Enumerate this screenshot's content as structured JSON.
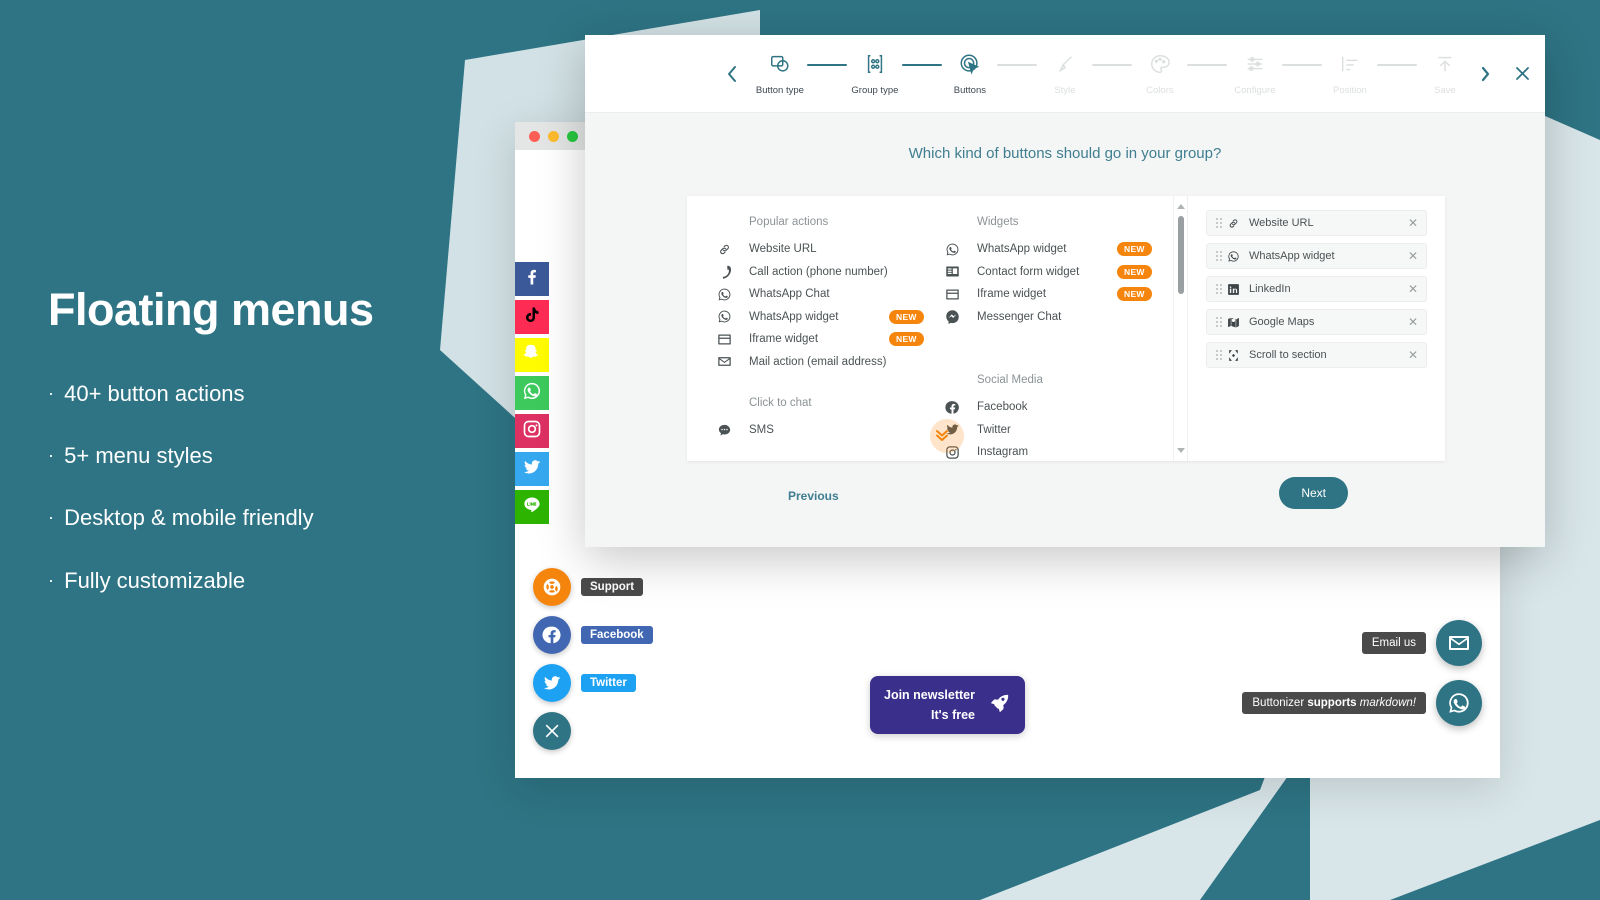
{
  "marketing": {
    "title": "Floating menus",
    "features": [
      "40+ button actions",
      "5+ menu styles",
      "Desktop & mobile friendly",
      "Fully customizable"
    ],
    "bullet": "·"
  },
  "theme": {
    "brand_teal": "#2e7484",
    "accent_orange": "#f5850c",
    "panel_bg": "#f4f5f5",
    "question_color": "#3f7e90"
  },
  "browser": {
    "traffic_lights": [
      "red",
      "yellow",
      "green"
    ],
    "social_rail": [
      {
        "name": "Facebook",
        "icon": "facebook-icon",
        "color": "#3b5998"
      },
      {
        "name": "TikTok",
        "icon": "tiktok-icon",
        "color": "#fe2c55"
      },
      {
        "name": "Snapchat",
        "icon": "snapchat-icon",
        "color": "#fffc00"
      },
      {
        "name": "WhatsApp",
        "icon": "whatsapp-icon",
        "color": "#3ec95c"
      },
      {
        "name": "Instagram",
        "icon": "instagram-icon",
        "color": "#dd3163"
      },
      {
        "name": "Twitter",
        "icon": "twitter-icon",
        "color": "#35a8f0"
      },
      {
        "name": "Line",
        "icon": "line-icon",
        "color": "#2cb400"
      }
    ],
    "fab_menu": [
      {
        "label": "Support",
        "icon": "lifebuoy-icon",
        "fab_color": "#f5850c",
        "label_color": "#4a4a4a"
      },
      {
        "label": "Facebook",
        "icon": "facebook-icon",
        "fab_color": "#4267b2",
        "label_color": "#4267b2"
      },
      {
        "label": "Twitter",
        "icon": "twitter-icon",
        "fab_color": "#1da1f2",
        "label_color": "#1da1f2"
      }
    ],
    "fab_close_icon": "close-icon",
    "newsletter": {
      "line1": "Join newsletter",
      "line2": "It's free",
      "icon": "rocket-icon",
      "color": "#3b2f8c"
    },
    "right_fabs": [
      {
        "label_plain": "Email us",
        "icon": "envelope-icon"
      },
      {
        "label_markdown": {
          "pre": "Buttonizer ",
          "bold": "supports ",
          "italic": "markdown!"
        },
        "icon": "whatsapp-icon"
      }
    ]
  },
  "modal": {
    "nav_prev_icon": "chevron-left-icon",
    "nav_next_icon": "chevron-right-icon",
    "close_icon": "close-icon",
    "steps": [
      {
        "label": "Button type",
        "icon": "button-type-icon",
        "state": "done"
      },
      {
        "label": "Group type",
        "icon": "group-type-icon",
        "state": "done"
      },
      {
        "label": "Buttons",
        "icon": "cursor-click-icon",
        "state": "active"
      },
      {
        "label": "Style",
        "icon": "brush-icon",
        "state": "todo"
      },
      {
        "label": "Colors",
        "icon": "palette-icon",
        "state": "todo"
      },
      {
        "label": "Configure",
        "icon": "sliders-icon",
        "state": "todo"
      },
      {
        "label": "Position",
        "icon": "align-icon",
        "state": "todo"
      },
      {
        "label": "Save",
        "icon": "upload-icon",
        "state": "todo"
      }
    ],
    "question": "Which kind of buttons should go in your group?",
    "catalog": {
      "columns": [
        {
          "groups": [
            {
              "heading": "Popular actions",
              "items": [
                {
                  "label": "Website URL",
                  "icon": "link-icon",
                  "badge": ""
                },
                {
                  "label": "Call action (phone number)",
                  "icon": "phone-icon",
                  "badge": ""
                },
                {
                  "label": "WhatsApp Chat",
                  "icon": "whatsapp-icon",
                  "badge": ""
                },
                {
                  "label": "WhatsApp widget",
                  "icon": "whatsapp-icon",
                  "badge": "NEW"
                },
                {
                  "label": "Iframe widget",
                  "icon": "iframe-icon",
                  "badge": "NEW"
                },
                {
                  "label": "Mail action (email address)",
                  "icon": "envelope-icon",
                  "badge": ""
                }
              ]
            },
            {
              "heading": "Click to chat",
              "items": [
                {
                  "label": "SMS",
                  "icon": "chat-icon",
                  "badge": ""
                }
              ]
            }
          ]
        },
        {
          "groups": [
            {
              "heading": "Widgets",
              "items": [
                {
                  "label": "WhatsApp widget",
                  "icon": "whatsapp-icon",
                  "badge": "NEW"
                },
                {
                  "label": "Contact form widget",
                  "icon": "form-icon",
                  "badge": "NEW"
                },
                {
                  "label": "Iframe widget",
                  "icon": "iframe-icon",
                  "badge": "NEW"
                },
                {
                  "label": "Messenger Chat",
                  "icon": "messenger-icon",
                  "badge": ""
                }
              ]
            },
            {
              "heading": "Social Media",
              "items": [
                {
                  "label": "Facebook",
                  "icon": "facebook-icon",
                  "badge": ""
                },
                {
                  "label": "Twitter",
                  "icon": "twitter-icon",
                  "badge": ""
                },
                {
                  "label": "Instagram",
                  "icon": "instagram-icon",
                  "badge": ""
                }
              ]
            }
          ]
        }
      ],
      "hover_cursor_on": "Instagram"
    },
    "selected": [
      {
        "label": "Website URL",
        "icon": "link-icon"
      },
      {
        "label": "WhatsApp widget",
        "icon": "whatsapp-icon"
      },
      {
        "label": "LinkedIn",
        "icon": "linkedin-icon"
      },
      {
        "label": "Google Maps",
        "icon": "google-maps-icon"
      },
      {
        "label": "Scroll to section",
        "icon": "scroll-to-section-icon"
      }
    ],
    "footer": {
      "previous_label": "Previous",
      "next_label": "Next"
    }
  }
}
